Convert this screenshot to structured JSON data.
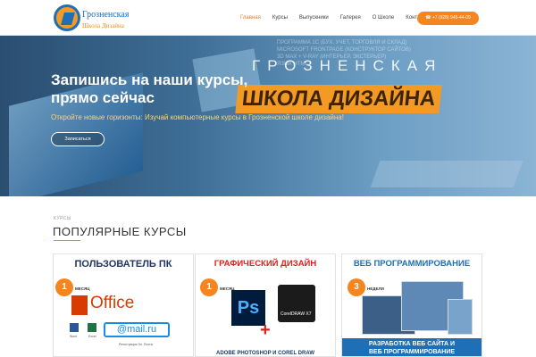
{
  "header": {
    "logo_line1": "Грозненская",
    "logo_line2": "Школа Дизайна",
    "nav": [
      "Главная",
      "Курсы",
      "Выпускники",
      "Галерея",
      "О Школе",
      "Контакты"
    ],
    "phone": "+7 (928) 945-44-09"
  },
  "hero": {
    "title": "Запишись на наши курсы, прямо сейчас",
    "subtitle": "Откройте новые горизонты: Изучай компьютерные курсы в Грозненской школе дизайна!",
    "button": "Записаться",
    "brand_line1": "ГРОЗНЕНСКАЯ",
    "brand_line2": "ШКОЛА ДИЗАЙНА",
    "bg_text": [
      "ПРОГРАММА 1С (БУХ. УЧЕТ, ТОРГОВЛЯ И СКЛАД)",
      "MICROSOFT FRONTPAGE (КОНСТРУКТОР САЙТОВ)",
      "3D MAX + V-RAY (ИНТЕРЬЕР, ЭКСТЕРЬЕР)",
      "ЯЗЫК HTML"
    ]
  },
  "section": {
    "eyebrow": "КУРСЫ",
    "title": "ПОПУЛЯРНЫЕ КУРСЫ"
  },
  "cards": [
    {
      "head": "ПОЛЬЗОВАТЕЛЬ ПК",
      "badge_num": "1",
      "badge_unit": "МЕСЯЦ",
      "main": "Office",
      "mail": "@mail.ru",
      "labels": [
        "Word",
        "Excel",
        "Регистрация Эл. Почты"
      ]
    },
    {
      "head": "ГРАФИЧЕСКИЙ ДИЗАЙН",
      "badge_num": "1",
      "badge_unit": "МЕСЯЦ",
      "ps": "Ps",
      "cdr": "CorelDRAW X7",
      "foot": "ADOBE PHOTOSHOP И COREL DRAW"
    },
    {
      "head": "ВЕБ ПРОГРАММИРОВАНИЕ",
      "badge_num": "3",
      "badge_unit": "НЕДЕЛИ",
      "foot_line1": "РАЗРАБОТКА ВЕБ САЙТА И",
      "foot_line2": "ВЕБ ПРОГРАММИРОВАНИЕ"
    }
  ],
  "colors": {
    "accent": "#f5851f",
    "brand_blue": "#1f6fb6"
  }
}
